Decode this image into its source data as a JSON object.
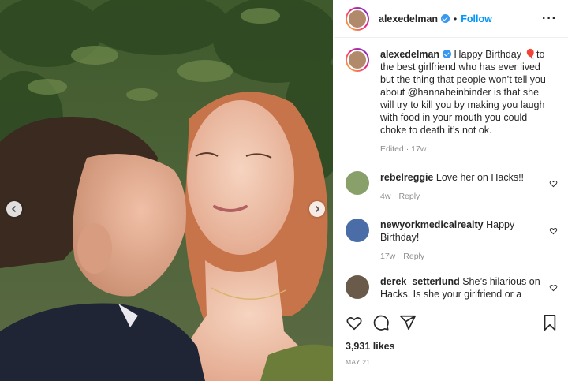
{
  "post": {
    "username": "alexedelman",
    "follow_label": "Follow",
    "dot": "•",
    "more": "···"
  },
  "caption": {
    "username": "alexedelman",
    "text": " Happy Birthday 🎈to the best girlfriend who has ever lived but the thing that people won’t tell you about @hannaheinbinder is that she will try to kill you by making you laugh with food in your mouth you could choke to death it’s not ok.",
    "edited": "Edited · 17w"
  },
  "comments": [
    {
      "username": "rebelreggie",
      "text": " Love her on Hacks!!",
      "age": "4w",
      "reply": "Reply"
    },
    {
      "username": "newyorkmedicalrealty",
      "text": " Happy Birthday!",
      "age": "17w",
      "reply": "Reply"
    },
    {
      "username": "derek_setterlund",
      "text": " She’s hilarious on Hacks. Is she your girlfriend or a",
      "age": "",
      "reply": ""
    }
  ],
  "stats": {
    "likes": "3,931 likes",
    "date": "MAY 21"
  },
  "colors": {
    "follow": "#0095f6",
    "verified": "#3897f0",
    "muted": "#8e8e8e"
  },
  "icons": [
    "chevron-left-icon",
    "chevron-right-icon",
    "verified-badge-icon",
    "more-icon",
    "heart-icon",
    "comment-icon",
    "share-icon",
    "save-icon"
  ]
}
